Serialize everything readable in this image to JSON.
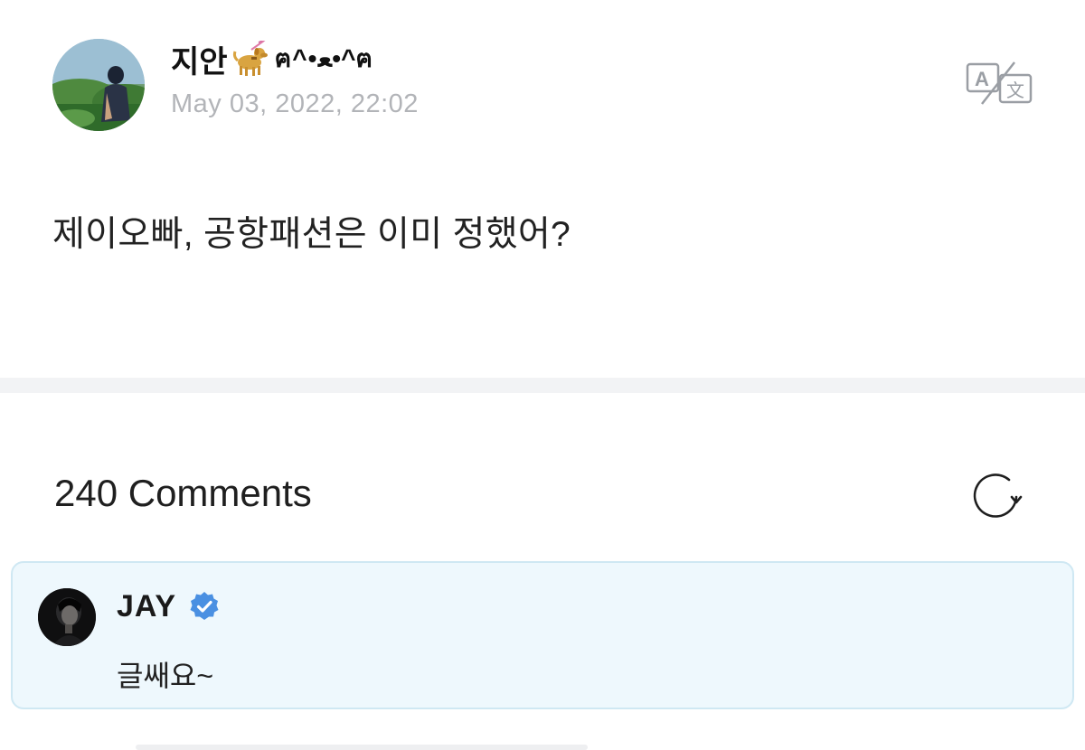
{
  "post": {
    "author_name": "지안",
    "author_kaomoji": "ฅ^•ﻌ•^ฅ",
    "timestamp": "May 03, 2022, 22:02",
    "body": "제이오빠, 공항패션은 이미 정했어?",
    "translate_icon": "translate-icon",
    "author_badge_icon": "guide-dog-emoji"
  },
  "comments": {
    "count_label": "240 Comments",
    "refresh_icon": "refresh-icon",
    "highlighted": {
      "author": "JAY",
      "verified_icon": "verified-badge-icon",
      "text": "글쌔요~"
    }
  },
  "colors": {
    "background": "#ffffff",
    "divider": "#f2f3f5",
    "timestamp": "#b2b4b8",
    "highlight_bg": "#eef8fd",
    "highlight_border": "#cfe8f3",
    "verified": "#4a90e2"
  }
}
